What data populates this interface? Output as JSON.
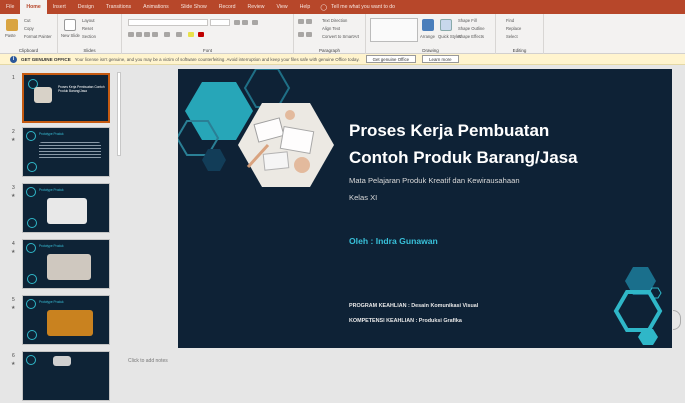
{
  "tabs": [
    "File",
    "Home",
    "Insert",
    "Design",
    "Transitions",
    "Animations",
    "Slide Show",
    "Record",
    "Review",
    "View",
    "Help"
  ],
  "active_tab": "Home",
  "tell_me": "Tell me what you want to do",
  "ribbon": {
    "groups": [
      "Clipboard",
      "Slides",
      "Font",
      "Paragraph",
      "Drawing",
      "Editing"
    ],
    "clipboard": {
      "paste": "Paste",
      "cut": "Cut",
      "copy": "Copy",
      "format_painter": "Format Painter"
    },
    "slides": {
      "new_slide": "New Slide",
      "layout": "Layout",
      "reset": "Reset",
      "section": "Section"
    },
    "paragraph": {
      "text_direction": "Text Direction",
      "align_text": "Align Text",
      "smartart": "Convert to SmartArt"
    },
    "drawing": {
      "arrange": "Arrange",
      "quick_styles": "Quick Styles",
      "shape_fill": "Shape Fill",
      "shape_outline": "Shape Outline",
      "shape_effects": "Shape Effects"
    },
    "editing": {
      "find": "Find",
      "replace": "Replace",
      "select": "Select"
    }
  },
  "message_bar": {
    "title": "GET GENUINE OFFICE",
    "text": "Your license isn't genuine, and you may be a victim of software counterfeiting. Avoid interruption and keep your files safe with genuine Office today.",
    "button1": "Get genuine Office",
    "button2": "Learn more"
  },
  "thumbnails": [
    {
      "num": "1",
      "title": "Proses Kerja Pembuatan Contoh Produk Barang/Jasa"
    },
    {
      "num": "2",
      "title": "Prototype Produk"
    },
    {
      "num": "3",
      "title": "Prototype Produk"
    },
    {
      "num": "4",
      "title": "Prototype Produk"
    },
    {
      "num": "5",
      "title": "Prototype Produk"
    },
    {
      "num": "6",
      "title": ""
    }
  ],
  "slide": {
    "title_line1": "Proses Kerja Pembuatan",
    "title_line2": "Contoh Produk Barang/Jasa",
    "subtitle1": "Mata Pelajaran Produk Kreatif dan Kewirausahaan",
    "subtitle2": "Kelas XI",
    "author": "Oleh : Indra Gunawan",
    "program": "PROGRAM KEAHLIAN : Desain Komunikasi Visual",
    "kompetensi": "KOMPETENSI KEAHLIAN : Produksi Grafika"
  },
  "notes_placeholder": "Click to add notes",
  "colors": {
    "accent": "#b7472a",
    "slide_bg": "#0e2236",
    "teal": "#2fb7c8",
    "author": "#38c0d9"
  }
}
